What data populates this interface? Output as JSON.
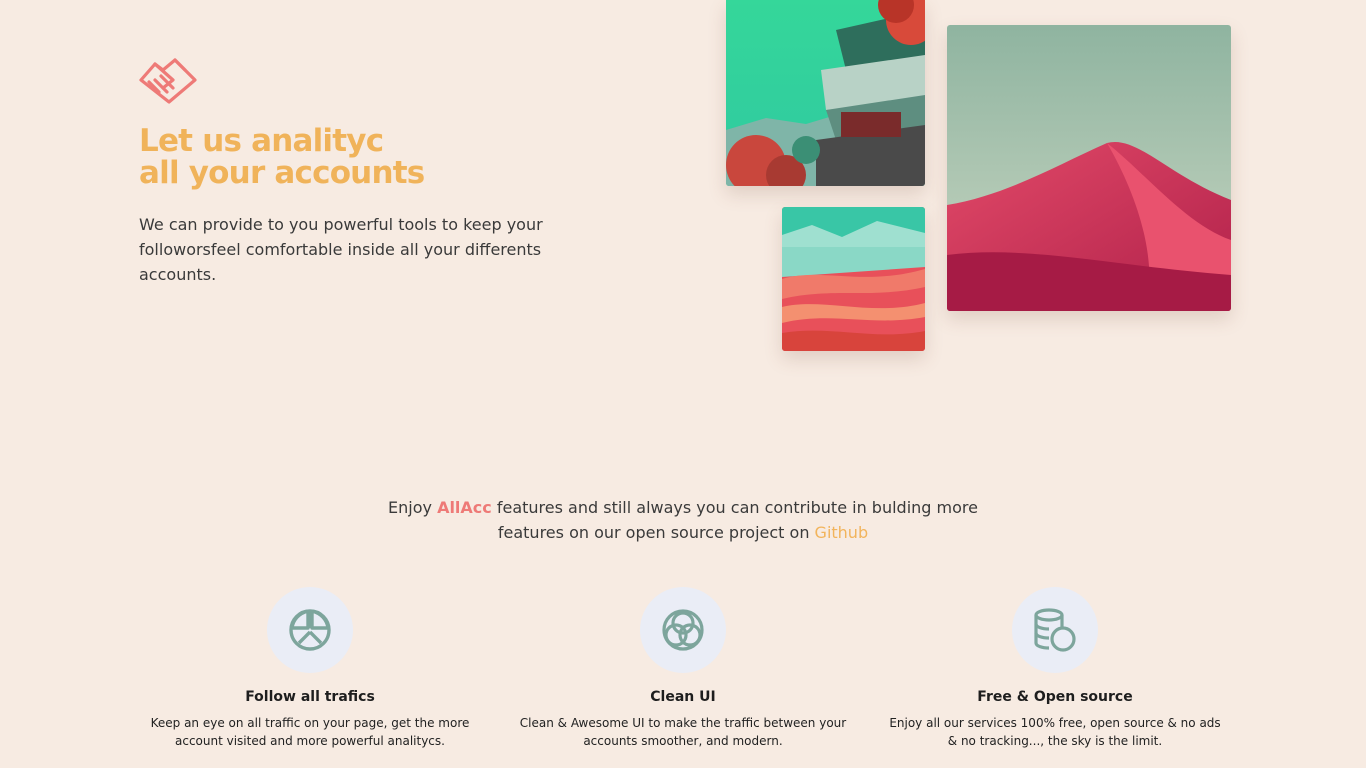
{
  "hero": {
    "logo_icon": "handshake-icon",
    "title_line1": "Let us analityc",
    "title_line2": "all your accounts",
    "description": "We can provide to you powerful tools to keep your followorsfeel comfortable inside all your differents accounts."
  },
  "gallery": [
    {
      "name": "temple-photo",
      "alt": "Pagoda among red trees"
    },
    {
      "name": "salt-flat-photo",
      "alt": "Red terraced landscape"
    },
    {
      "name": "desert-dune-photo",
      "alt": "Pink desert dune"
    }
  ],
  "intro": {
    "before": "Enjoy ",
    "brand": "AllAcc",
    "middle": " features and still always you can contribute in bulding more features on our open source project on ",
    "link": "Github"
  },
  "features": [
    {
      "icon": "pie-chart-icon",
      "title": "Follow all trafics",
      "text": "Keep an eye on all traffic on your page, get the more account visited and more powerful analitycs."
    },
    {
      "icon": "venn-circles-icon",
      "title": "Clean UI",
      "text": "Clean & Awesome UI to make the traffic between your accounts smoother, and modern."
    },
    {
      "icon": "coins-icon",
      "title": "Free & Open source",
      "text": "Enjoy all our services 100% free, open source & no ads & no tracking..., the sky is the limit."
    }
  ],
  "colors": {
    "background": "#f7ebe2",
    "accent_title": "#f0b35a",
    "brand": "#ee7a77",
    "link": "#f2b45c",
    "icon_circle": "#eaedf6",
    "icon_stroke": "#7da59c"
  }
}
